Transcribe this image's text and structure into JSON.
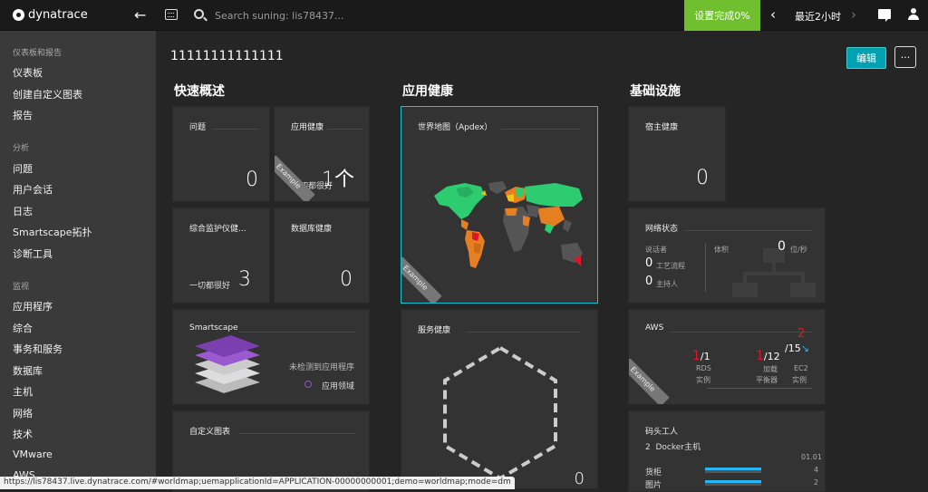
{
  "topbar": {
    "logo_text": "dynatrace",
    "search_placeholder": "Search suning: lis78437...",
    "setup_label": "设置完成0%",
    "timeframe_label": "最近2小时"
  },
  "sidebar": {
    "sections": [
      {
        "label": "仪表板和报告",
        "items": [
          "仪表板",
          "创建自定义图表",
          "报告"
        ]
      },
      {
        "label": "分析",
        "items": [
          "问题",
          "用户会话",
          "日志",
          "Smartscape拓扑",
          "诊断工具"
        ]
      },
      {
        "label": "监视",
        "items": [
          "应用程序",
          "综合",
          "事务和服务",
          "数据库",
          "主机",
          "网络",
          "技术",
          "VMware",
          "AWS"
        ]
      }
    ]
  },
  "main": {
    "dashboard_title": "11111111111111",
    "edit_label": "编辑",
    "more_label": "···",
    "columns": [
      "快速概述",
      "应用健康",
      "基础设施"
    ],
    "example_label": "Example",
    "tiles": {
      "problems": {
        "title": "问题",
        "value": "0"
      },
      "app_health": {
        "title": "应用健康",
        "value": "1个",
        "sub": "切都很好"
      },
      "synthetic": {
        "title": "综合监护仪健...",
        "value": "3",
        "sub": "一切都很好"
      },
      "db_health": {
        "title": "数据库健康",
        "value": "0"
      },
      "smartscape": {
        "title": "Smartscape",
        "note": "未检测到应用程序",
        "legend": "应用领域"
      },
      "custom_charts": {
        "title": "自定义图表"
      },
      "world_map": {
        "title": "世界地图（Apdex）"
      },
      "service_health": {
        "title": "服务健康",
        "value": "0"
      },
      "host_health": {
        "title": "宿主健康",
        "value": "0"
      },
      "network": {
        "title": "网络状态",
        "talkers_label": "说话者",
        "volume_label": "体积",
        "volume_value": "0",
        "volume_unit": "位/秒",
        "flows_value": "0",
        "flows_label": "工艺流程",
        "hosts_value": "0",
        "hosts_label": "主持人"
      },
      "aws": {
        "title": "AWS",
        "items": [
          {
            "alert": "1",
            "total": "/1",
            "label1": "RDS",
            "label2": "实例"
          },
          {
            "alert": "1",
            "total": "/12",
            "label1": "加载",
            "label2": "平衡器"
          },
          {
            "alert": "2",
            "total": "/15",
            "label1": "EC2",
            "label2": "实例"
          }
        ]
      },
      "docker": {
        "title": "码头工人",
        "hosts_count": "2",
        "hosts_label": "Docker主机",
        "date": "01.01",
        "rows": [
          {
            "label": "货柜",
            "value": "4"
          },
          {
            "label": "图片",
            "value": "2"
          }
        ]
      }
    }
  },
  "status_url": "https://lis78437.live.dynatrace.com/#worldmap;uemapplicationId=APPLICATION-00000000001;demo=worldmap;mode=dm",
  "colors": {
    "accent": "#00a1b2",
    "setup": "#6fbf2e",
    "alert": "#dc172a",
    "selected_border": "#18c4d4"
  }
}
